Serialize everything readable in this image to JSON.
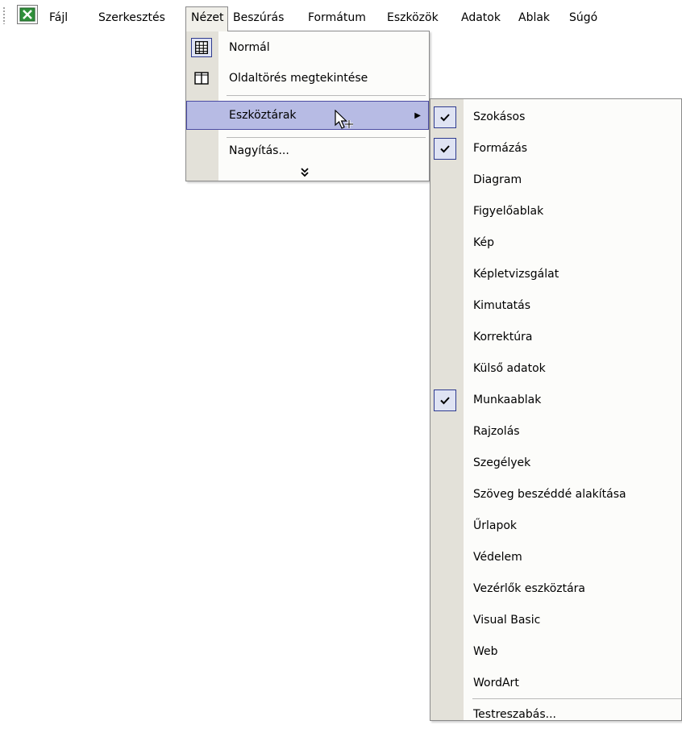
{
  "menubar": {
    "items": [
      {
        "label": "Fájl"
      },
      {
        "label": "Szerkesztés"
      },
      {
        "label": "Nézet"
      },
      {
        "label": "Beszúrás"
      },
      {
        "label": "Formátum"
      },
      {
        "label": "Eszközök"
      },
      {
        "label": "Adatok"
      },
      {
        "label": "Ablak"
      },
      {
        "label": "Súgó"
      }
    ]
  },
  "view_menu": {
    "items": [
      {
        "label": "Normál",
        "icon": "normal-view-icon"
      },
      {
        "label": "Oldaltörés megtekintése",
        "icon": "page-break-preview-icon"
      },
      {
        "label": "Eszköztárak",
        "has_submenu": true
      },
      {
        "label": "Nagyítás..."
      }
    ],
    "expand_glyph": "»"
  },
  "toolbars_submenu": {
    "items": [
      {
        "label": "Szokásos",
        "checked": true
      },
      {
        "label": "Formázás",
        "checked": true
      },
      {
        "label": "Diagram",
        "checked": false
      },
      {
        "label": "Figyelőablak",
        "checked": false
      },
      {
        "label": "Kép",
        "checked": false
      },
      {
        "label": "Képletvizsgálat",
        "checked": false
      },
      {
        "label": "Kimutatás",
        "checked": false
      },
      {
        "label": "Korrektúra",
        "checked": false
      },
      {
        "label": "Külső adatok",
        "checked": false
      },
      {
        "label": "Munkaablak",
        "checked": true
      },
      {
        "label": "Rajzolás",
        "checked": false
      },
      {
        "label": "Szegélyek",
        "checked": false
      },
      {
        "label": "Szöveg beszéddé alakítása",
        "checked": false
      },
      {
        "label": "Űrlapok",
        "checked": false
      },
      {
        "label": "Védelem",
        "checked": false
      },
      {
        "label": "Vezérlők eszköztára",
        "checked": false
      },
      {
        "label": "Visual Basic",
        "checked": false
      },
      {
        "label": "Web",
        "checked": false
      },
      {
        "label": "WordArt",
        "checked": false
      },
      {
        "label": "Testreszabás..."
      }
    ]
  },
  "colors": {
    "highlight": "#b7bbe4",
    "highlight_border": "#4b4ba3",
    "gutter": "#e3e1d9",
    "menu_background": "#fcfcfa"
  }
}
